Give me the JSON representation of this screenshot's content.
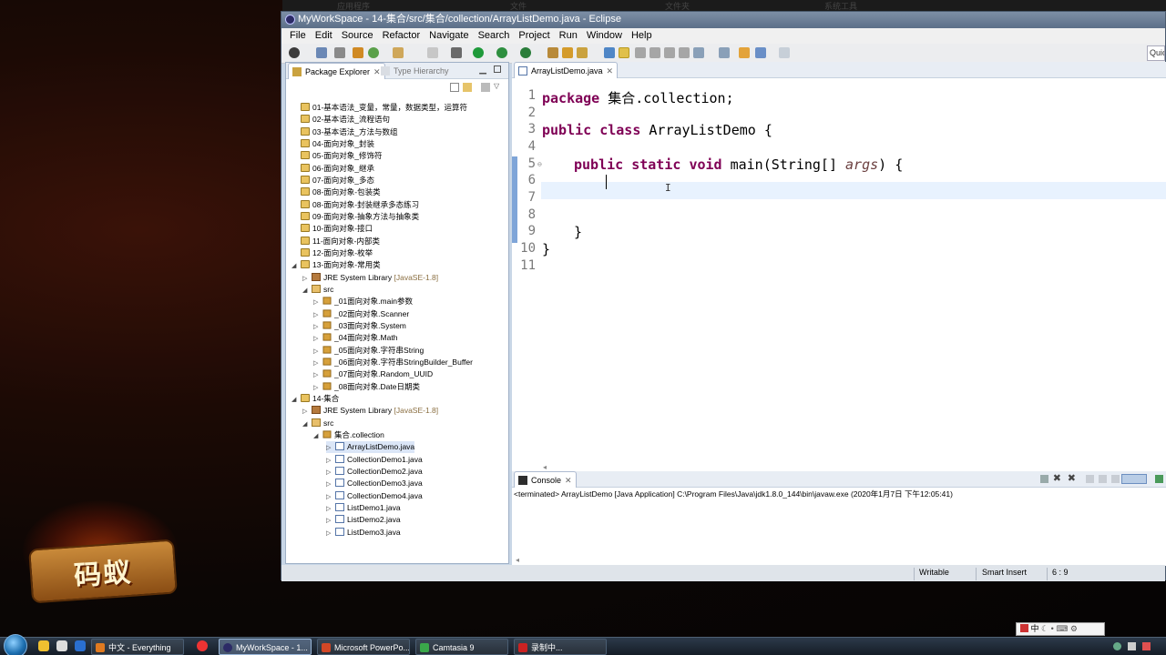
{
  "background_window": {
    "labels": [
      "应用程序",
      "文件",
      "文件夹",
      "系统工具"
    ]
  },
  "window": {
    "title": "MyWorkSpace - 14-集合/src/集合/collection/ArrayListDemo.java - Eclipse"
  },
  "menu": [
    "File",
    "Edit",
    "Source",
    "Refactor",
    "Navigate",
    "Search",
    "Project",
    "Run",
    "Window",
    "Help"
  ],
  "toolbar": {
    "quick_access": "Quic"
  },
  "package_explorer": {
    "tab_label": "Package Explorer",
    "other_tab_label": "Type Hierarchy",
    "projects": [
      "01-基本语法_变量，常量，数据类型，运算符",
      "02-基本语法_流程语句",
      "03-基本语法_方法与数组",
      "04-面向对象_封装",
      "05-面向对象_修饰符",
      "06-面向对象_继承",
      "07-面向对象_多态",
      "08-面向对象-包装类",
      "08-面向对象-封装继承多态练习",
      "09-面向对象-抽象方法与抽象类",
      "10-面向对象-接口",
      "11-面向对象-内部类",
      "12-面向对象-枚举"
    ],
    "project13": {
      "name": "13-面向对象-常用类",
      "jre": "JRE System Library",
      "jre_version": "[JavaSE-1.8]",
      "src": "src",
      "packages": [
        "_01面向对象.main参数",
        "_02面向对象.Scanner",
        "_03面向对象.System",
        "_04面向对象.Math",
        "_05面向对象.字符串String",
        "_06面向对象.字符串StringBuilder_Buffer",
        "_07面向对象.Random_UUID",
        "_08面向对象.Date日期类"
      ]
    },
    "project14": {
      "name": "14-集合",
      "jre": "JRE System Library",
      "jre_version": "[JavaSE-1.8]",
      "src": "src",
      "package": "集合.collection",
      "files": [
        "ArrayListDemo.java",
        "CollectionDemo1.java",
        "CollectionDemo2.java",
        "CollectionDemo3.java",
        "CollectionDemo4.java",
        "ListDemo1.java",
        "ListDemo2.java",
        "ListDemo3.java"
      ]
    }
  },
  "editor": {
    "tab_label": "ArrayListDemo.java",
    "line_numbers": [
      "1",
      "2",
      "3",
      "4",
      "5",
      "6",
      "7",
      "8",
      "9",
      "10",
      "11"
    ],
    "code": {
      "l1_kw": "package",
      "l1_rest": " 集合.collection;",
      "l3_kw1": "public",
      "l3_kw2": "class",
      "l3_rest": " ArrayListDemo {",
      "l5_kw1": "public",
      "l5_kw2": "static",
      "l5_kw3": "void",
      "l5_mid": " main(String[] ",
      "l5_arg": "args",
      "l5_end": ") {",
      "l9": "}",
      "l10": "}"
    }
  },
  "console": {
    "tab_label": "Console",
    "text": "<terminated> ArrayListDemo [Java Application] C:\\Program Files\\Java\\jdk1.8.0_144\\bin\\javaw.exe (2020年1月7日 下午12:05:41)"
  },
  "status": {
    "writable": "Writable",
    "insert_mode": "Smart Insert",
    "position": "6 : 9"
  },
  "taskbar": {
    "items": [
      "中文 - Everything",
      "MyWorkSpace - 1...",
      "Microsoft PowerPo...",
      "Camtasia 9",
      "录制中..."
    ],
    "ime_label": "中"
  }
}
